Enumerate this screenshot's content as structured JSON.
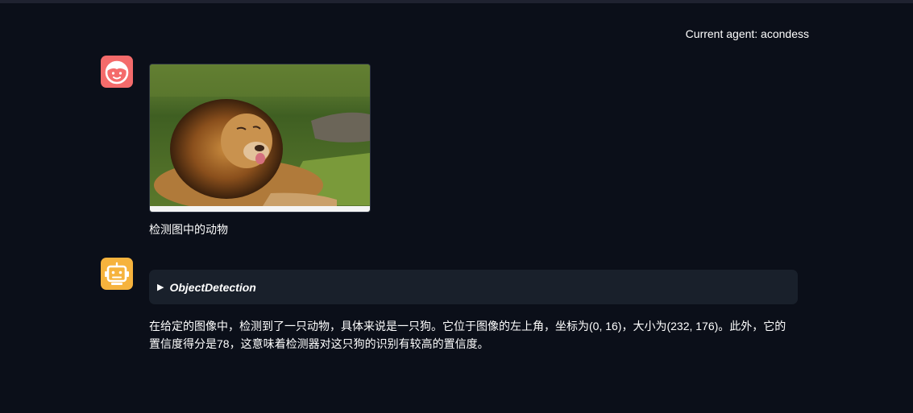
{
  "header": {
    "current_agent": "Current agent: acondess"
  },
  "messages": [
    {
      "role": "user",
      "avatar_icon": "user-face-icon",
      "image_alt": "lion",
      "text": "检测图中的动物"
    },
    {
      "role": "assistant",
      "avatar_icon": "robot-icon",
      "tool_call": {
        "arrow": "▶",
        "name": "ObjectDetection"
      },
      "text": "在给定的图像中，检测到了一只动物，具体来说是一只狗。它位于图像的左上角，坐标为(0, 16)，大小为(232, 176)。此外，它的置信度得分是78，这意味着检测器对这只狗的识别有较高的置信度。"
    }
  ],
  "colors": {
    "background": "#0b0f19",
    "user_avatar": "#f46b6b",
    "bot_avatar": "#f6b33d",
    "tool_box": "#19202b"
  }
}
